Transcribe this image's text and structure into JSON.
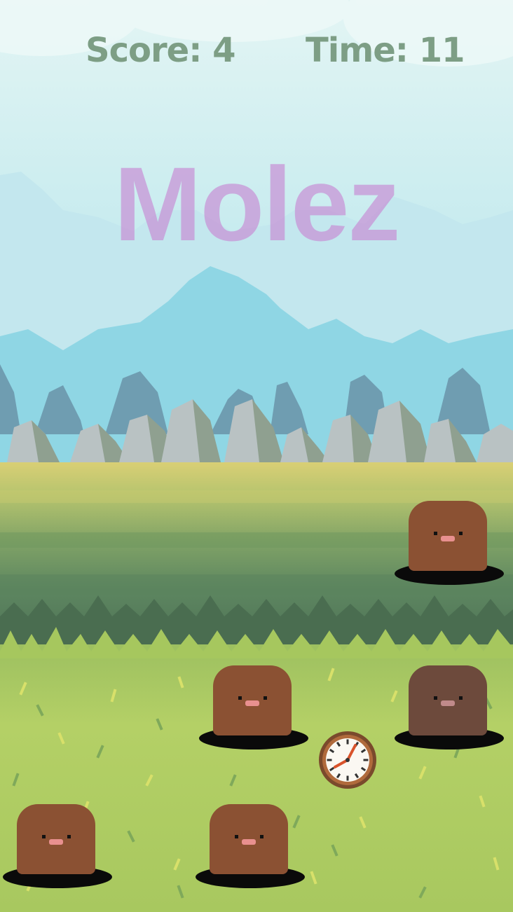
{
  "hud": {
    "score_label": "Score:",
    "score_value": "4",
    "time_label": "Time:",
    "time_value": "11"
  },
  "title": "Molez",
  "colors": {
    "sky_top": "#d8f1f1",
    "sky_bottom": "#a9e4ec",
    "cloud": "#c3e8ee",
    "mountain_far": "#8fd6e4",
    "mountain_dark": "#6f9db1",
    "rock_light": "#b9c2c3",
    "rock_shadow": "#8fa090",
    "grass_yellow": "#d9cf75",
    "grass_mid": "#87a86a",
    "grass_dark": "#55795c",
    "grass_bright": "#b9d26b",
    "hud_text": "#7d9e85",
    "title_text": "#c792d6",
    "mole_brown": "#8b5133",
    "mole_dark": "#6d4a3c",
    "mole_nose": "#e8908f",
    "mole_hole": "#0a0a0a"
  },
  "moles": [
    {
      "name": "mole-top-right",
      "body_color": "#8b5133",
      "nose_color": "#e8908f"
    },
    {
      "name": "mole-middle-center",
      "body_color": "#8b5133",
      "nose_color": "#e8908f"
    },
    {
      "name": "mole-middle-right",
      "body_color": "#6d4a3c",
      "nose_color": "#c08a8a"
    },
    {
      "name": "mole-bottom-left",
      "body_color": "#8b5133",
      "nose_color": "#e8908f"
    },
    {
      "name": "mole-bottom-center",
      "body_color": "#8b5133",
      "nose_color": "#e8908f"
    }
  ],
  "powerup": {
    "icon": "clock-icon"
  }
}
